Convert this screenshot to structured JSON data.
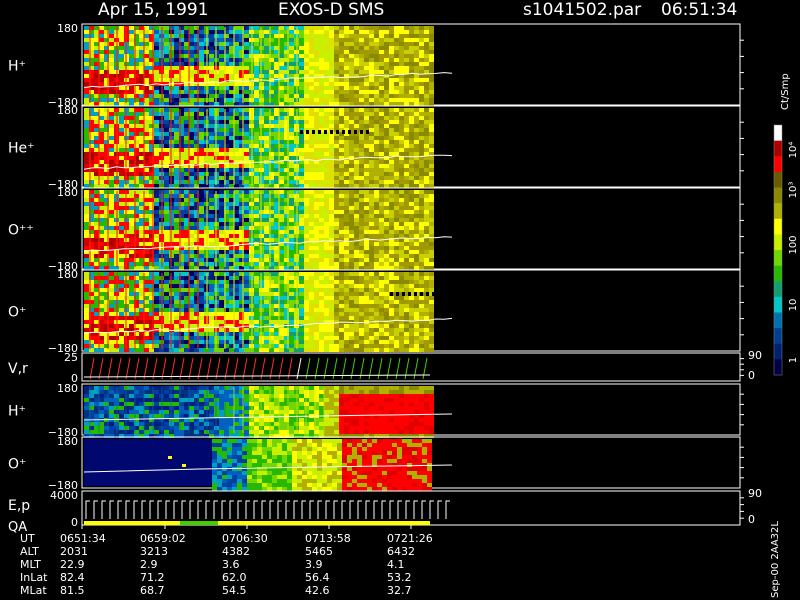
{
  "header": {
    "date": "Apr 15, 1991",
    "instrument": "EXOS-D SMS",
    "file": "s1041502.par",
    "time": "06:51:34"
  },
  "side_text": "Sep-00  2AA32L",
  "colorbar": {
    "title": "Ct/Smp",
    "ticks": [
      "10⁴",
      "10³",
      "100",
      "10",
      "1"
    ],
    "colors": [
      "#ffffff",
      "#b00000",
      "#ff0000",
      "#6b5a00",
      "#8a8a00",
      "#b0b000",
      "#ffff00",
      "#c8f000",
      "#70d800",
      "#28b800",
      "#10a070",
      "#00c8c8",
      "#0070b0",
      "#004090",
      "#002070",
      "#000040"
    ]
  },
  "footer": {
    "labels": [
      "UT",
      "ALT",
      "MLT",
      "InLat",
      "MLat"
    ],
    "columns": [
      {
        "UT": "0651:34",
        "ALT": "2031",
        "MLT": "22.9",
        "InLat": "82.4",
        "MLat": "81.5"
      },
      {
        "UT": "0659:02",
        "ALT": "3213",
        "MLT": "2.9",
        "InLat": "71.2",
        "MLat": "68.7"
      },
      {
        "UT": "0706:30",
        "ALT": "4382",
        "MLT": "3.6",
        "InLat": "62.0",
        "MLat": "54.5"
      },
      {
        "UT": "0713:58",
        "ALT": "5465",
        "MLT": "3.9",
        "InLat": "56.4",
        "MLat": "42.6"
      },
      {
        "UT": "0721:26",
        "ALT": "6432",
        "MLT": "4.1",
        "InLat": "53.2",
        "MLat": "32.7"
      }
    ]
  },
  "chart_data": {
    "type": "heatmap",
    "panels": [
      {
        "id": "h-plus-1",
        "label": "H⁺",
        "y_top_label": "180",
        "y_bottom_label": "−180",
        "ylim": [
          -180,
          180
        ],
        "kind": "ion-top"
      },
      {
        "id": "he-plus",
        "label": "He⁺",
        "y_top_label": "180",
        "y_bottom_label": "−180",
        "ylim": [
          -180,
          180
        ],
        "kind": "ion-top"
      },
      {
        "id": "o-plus-plus",
        "label": "O⁺⁺",
        "y_top_label": "180",
        "y_bottom_label": "−180",
        "ylim": [
          -180,
          180
        ],
        "kind": "ion-top"
      },
      {
        "id": "o-plus-1",
        "label": "O⁺",
        "y_top_label": "180",
        "y_bottom_label": "−180",
        "ylim": [
          -180,
          180
        ],
        "kind": "ion-top"
      },
      {
        "id": "vr",
        "label": "V,r",
        "y_top_label": "25",
        "y_bottom_label": "0",
        "right_top_label": "90",
        "right_bottom_label": "0",
        "kind": "line"
      },
      {
        "id": "h-plus-2",
        "label": "H⁺",
        "y_top_label": "180",
        "y_bottom_label": "−180",
        "ylim": [
          -180,
          180
        ],
        "kind": "ion-bottom-h"
      },
      {
        "id": "o-plus-2",
        "label": "O⁺",
        "y_top_label": "180",
        "y_bottom_label": "−180",
        "ylim": [
          -180,
          180
        ],
        "kind": "ion-bottom-o"
      },
      {
        "id": "ep-qa",
        "label": "E,p",
        "label2": "QA",
        "y_top_label": "4000",
        "y_bottom_label": "0",
        "right_top_label": "90",
        "right_bottom_label": "0",
        "kind": "energy"
      }
    ],
    "x_ticks": [
      "0651:34",
      "0659:02",
      "0706:30",
      "0713:58",
      "0721:26"
    ]
  }
}
